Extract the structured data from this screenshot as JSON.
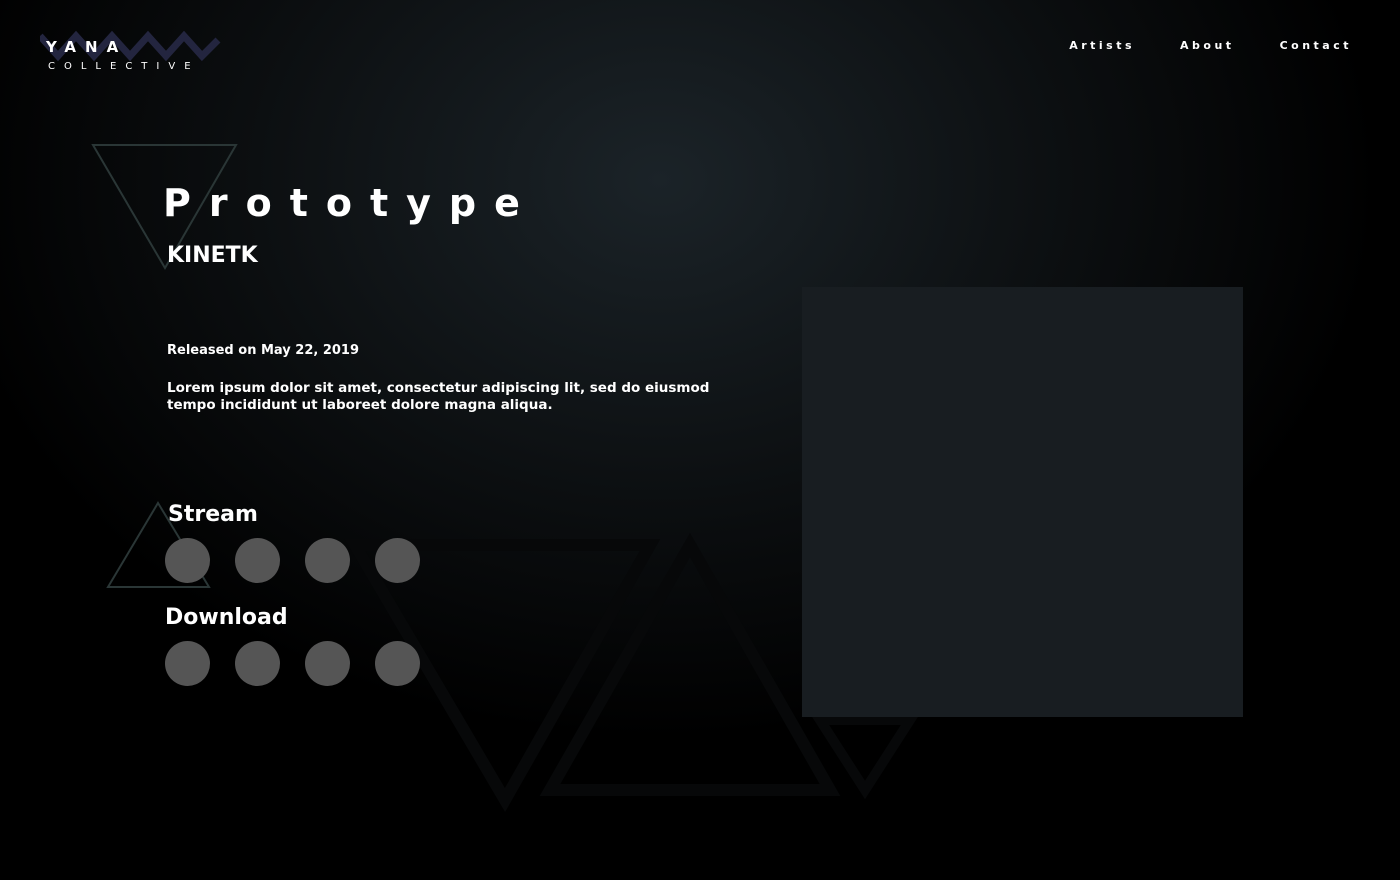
{
  "header": {
    "logo": {
      "name": "YANA",
      "subtitle": "COLLECTIVE"
    },
    "nav": [
      "Artists",
      "About",
      "Contact"
    ]
  },
  "release": {
    "title": "Prototype",
    "artist": "KINETK",
    "release_date": "Released on May 22, 2019",
    "description": "Lorem ipsum dolor sit amet, consectetur adipiscing lit, sed do eiusmod tempo incididunt ut laboreet dolore magna aliqua."
  },
  "stream": {
    "label": "Stream",
    "services": [
      "circle-icon",
      "circle-icon",
      "circle-icon",
      "circle-icon"
    ]
  },
  "download": {
    "label": "Download",
    "services": [
      "circle-icon",
      "circle-icon",
      "circle-icon",
      "circle-icon"
    ]
  },
  "colors": {
    "background": "#000000",
    "glow": "#1b2328",
    "icon_placeholder": "#555555",
    "cover_placeholder": "#181d21",
    "logo_accent": "#23253f",
    "triangle_outline": "#2a3636"
  }
}
